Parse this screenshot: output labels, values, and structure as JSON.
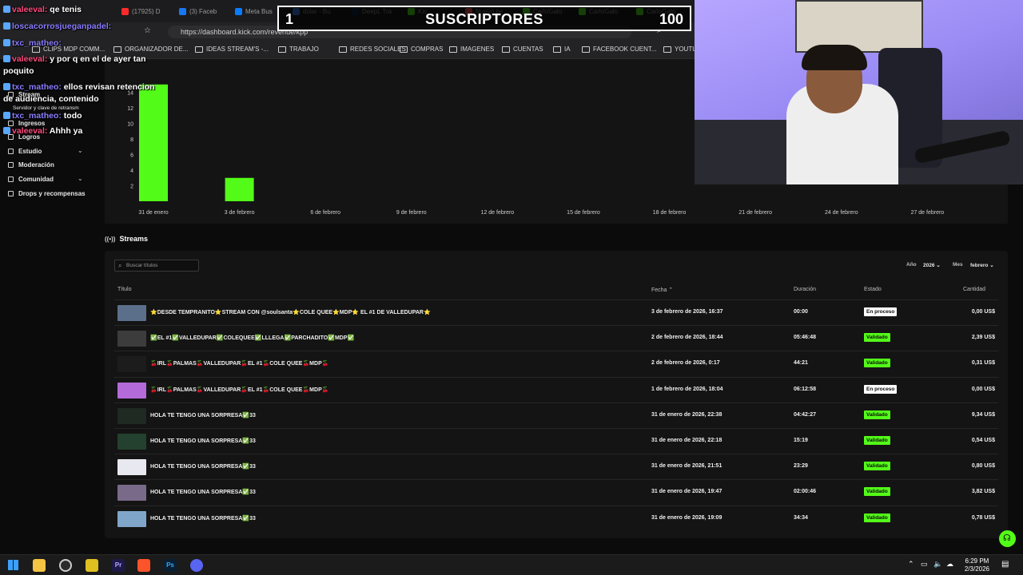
{
  "browser": {
    "tabs": [
      {
        "label": "(17925) D",
        "color": "#ff2a2a"
      },
      {
        "label": "(3) Faceb",
        "color": "#1877f2"
      },
      {
        "label": "Meta Bus",
        "color": "#0a7cff"
      },
      {
        "label": "dolar - Bu",
        "color": "#4285f4"
      },
      {
        "label": "DeepL Tra",
        "color": "#0f2b46"
      },
      {
        "label": "Kic",
        "color": "#53fc18"
      },
      {
        "label": "Nuevo pe",
        "color": "#ff5a5a"
      },
      {
        "label": "CarloGato",
        "color": "#53fc18"
      },
      {
        "label": "CarloGato",
        "color": "#53fc18"
      },
      {
        "label": "CarloGato",
        "color": "#53fc18"
      }
    ],
    "url": "https://dashboard.kick.com/revenue/kpp",
    "bookmarks": [
      "CLIPS MDP COMM...",
      "ORGANIZADOR DE...",
      "IDEAS STREAM'S -...",
      "TRABAJO",
      "REDES SOCIALES",
      "COMPRAS",
      "IMAGENES",
      "CUENTAS",
      "IA",
      "FACEBOOK CUENT...",
      "YOUTU"
    ]
  },
  "overlay": {
    "subs_current": "1",
    "subs_title": "SUSCRIPTORES",
    "subs_goal": "100",
    "chat": [
      {
        "user": "valeeval:",
        "msg": "qe tenis",
        "pink": true
      },
      {
        "user": "loscacorrosjueganpadel:",
        "msg": "",
        "pink": false
      },
      {
        "user": "txc_matheo:",
        "msg": "",
        "pink": false
      },
      {
        "user": "valeeval:",
        "msg": "y por q en el de ayer tan",
        "pink": true
      },
      {
        "user": "",
        "msg": "poquito",
        "pink": false
      },
      {
        "user": "txc_matheo:",
        "msg": "ellos revisan retencion",
        "pink": false
      },
      {
        "user": "",
        "msg": "de audiencia, contenido",
        "pink": false
      },
      {
        "user": "txc_matheo:",
        "msg": "todo",
        "pink": false
      },
      {
        "user": "valeeval:",
        "msg": "Ahhh ya",
        "pink": true
      }
    ]
  },
  "sidebar": {
    "items": [
      {
        "label": "Stream",
        "has_chevron": false
      },
      {
        "label": "Servidor y clave de retransm",
        "has_chevron": false
      },
      {
        "label": "Ingresos",
        "has_chevron": false
      },
      {
        "label": "Logros",
        "has_chevron": false
      },
      {
        "label": "Estudio",
        "has_chevron": true
      },
      {
        "label": "Moderación",
        "has_chevron": false
      },
      {
        "label": "Comunidad",
        "has_chevron": true
      },
      {
        "label": "Drops y recompensas",
        "has_chevron": false
      }
    ]
  },
  "chart_data": {
    "type": "bar",
    "categories": [
      "31 de enero",
      "3 de febrero",
      "6 de febrero",
      "9 de febrero",
      "12 de febrero",
      "15 de febrero",
      "18 de febrero",
      "21 de febrero",
      "24 de febrero",
      "27 de febrero"
    ],
    "values": [
      15,
      3,
      0,
      0,
      0,
      0,
      0,
      0,
      0,
      0
    ],
    "yticks": [
      "2",
      "4",
      "6",
      "8",
      "10",
      "12",
      "14"
    ],
    "ylim": [
      0,
      16
    ],
    "color": "#53fc18"
  },
  "streams": {
    "title": "Streams",
    "search_placeholder": "Buscar títulos",
    "filter_year_label": "Año",
    "filter_year_value": "2026",
    "filter_month_label": "Mes",
    "filter_month_value": "febrero",
    "columns": {
      "title": "Título",
      "date": "Fecha",
      "duration": "Duración",
      "status": "Estado",
      "amount": "Cantidad"
    },
    "rows": [
      {
        "title": "⭐DESDE TEMPRANITO⭐STREAM CON @soulsanta⭐COLE QUEE⭐MDP⭐ EL #1 DE VALLEDUPAR⭐",
        "date": "3 de febrero de 2026, 16:37",
        "duration": "00:00",
        "status": "En proceso",
        "amount": "0,00 US$",
        "thumb": "#5b6f8a"
      },
      {
        "title": "✅EL #1✅VALLEDUPAR✅COLEQUEE✅LLLEGA✅PARCHADITO✅MDP✅",
        "date": "2 de febrero de 2026, 18:44",
        "duration": "05:46:48",
        "status": "Validado",
        "amount": "2,39 US$",
        "thumb": "#3c3c3c"
      },
      {
        "title": "🍒IRL🍒PALMAS🍒VALLEDUPAR🍒EL #1🍒COLE QUEE🍒MDP🍒",
        "date": "2 de febrero de 2026, 0:17",
        "duration": "44:21",
        "status": "Validado",
        "amount": "0,31 US$",
        "thumb": "#1c1c1c"
      },
      {
        "title": "🍒IRL🍒PALMAS🍒VALLEDUPAR🍒EL #1🍒COLE QUEE🍒MDP🍒",
        "date": "1 de febrero de 2026, 18:04",
        "duration": "06:12:58",
        "status": "En proceso",
        "amount": "0,00 US$",
        "thumb": "#b46ad8"
      },
      {
        "title": "HOLA TE TENGO UNA SORPRESA✅33",
        "date": "31 de enero de 2026, 22:38",
        "duration": "04:42:27",
        "status": "Validado",
        "amount": "9,34 US$",
        "thumb": "#1e2a22"
      },
      {
        "title": "HOLA TE TENGO UNA SORPRESA✅33",
        "date": "31 de enero de 2026, 22:18",
        "duration": "15:19",
        "status": "Validado",
        "amount": "0,54 US$",
        "thumb": "#24402e"
      },
      {
        "title": "HOLA TE TENGO UNA SORPRESA✅33",
        "date": "31 de enero de 2026, 21:51",
        "duration": "23:29",
        "status": "Validado",
        "amount": "0,80 US$",
        "thumb": "#e8e8f0"
      },
      {
        "title": "HOLA TE TENGO UNA SORPRESA✅33",
        "date": "31 de enero de 2026, 19:47",
        "duration": "02:00:46",
        "status": "Validado",
        "amount": "3,82 US$",
        "thumb": "#7a6a8a"
      },
      {
        "title": "HOLA TE TENGO UNA SORPRESA✅33",
        "date": "31 de enero de 2026, 19:09",
        "duration": "34:34",
        "status": "Validado",
        "amount": "0,78 US$",
        "thumb": "#7fa6c8"
      }
    ]
  },
  "taskbar": {
    "time": "6:29 PM",
    "date": "2/3/2026"
  }
}
